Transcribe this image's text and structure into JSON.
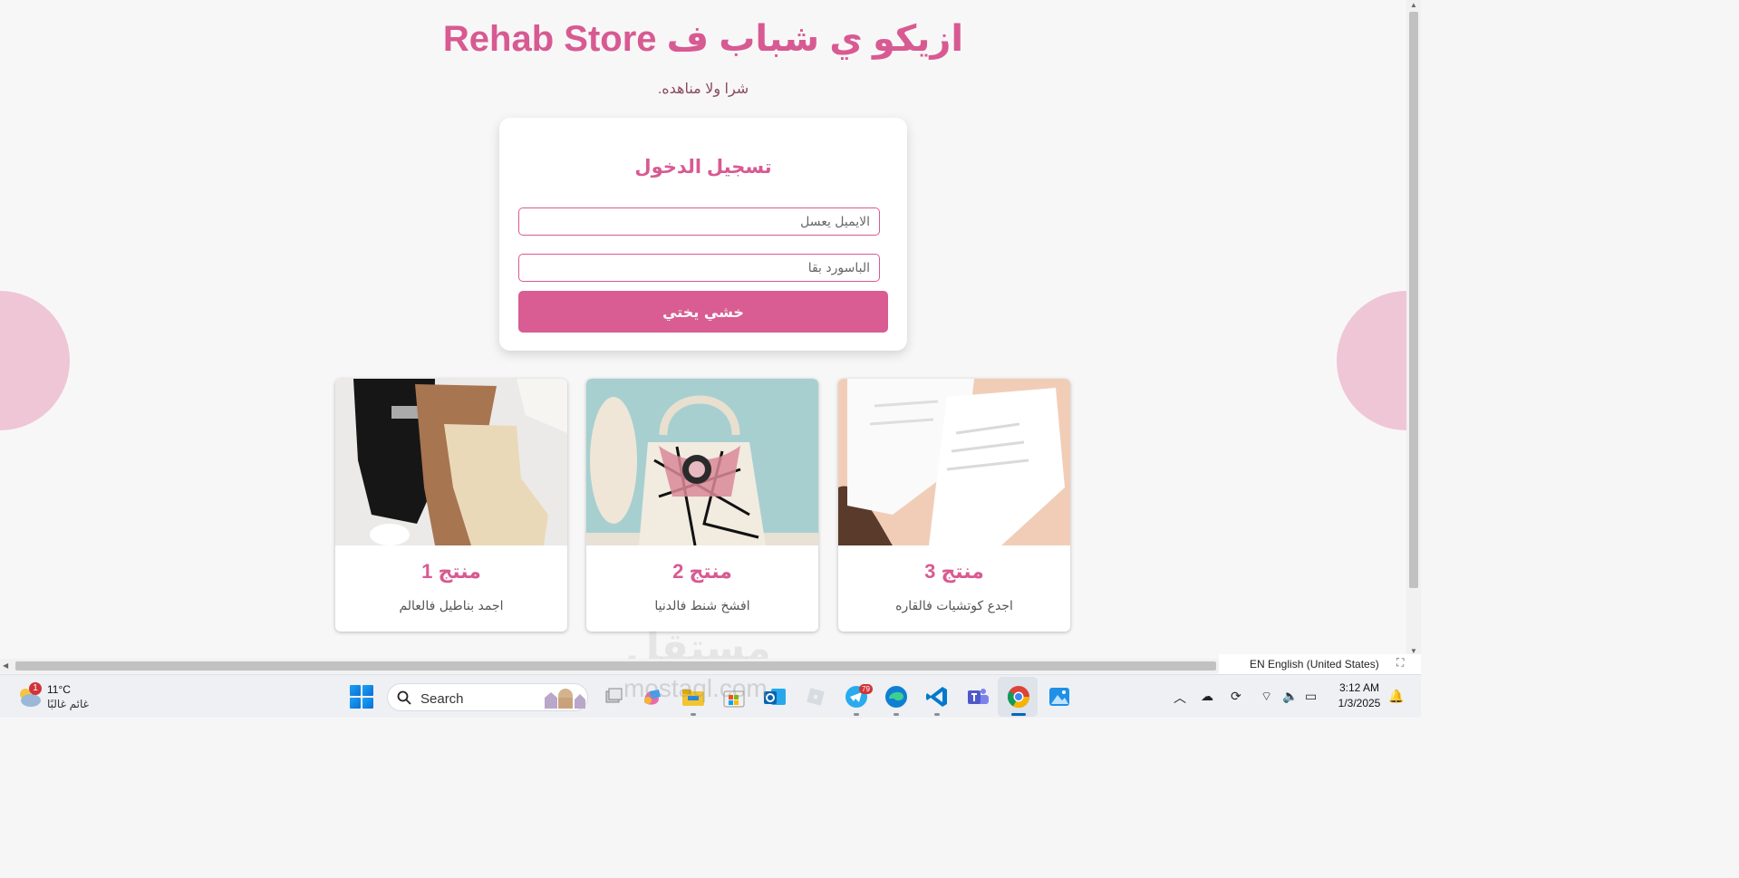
{
  "site": {
    "title": "ازيكو ي شباب ف Rehab Store",
    "tagline": "شرا ولا مناهده."
  },
  "login": {
    "title": "تسجيل الدخول",
    "email_placeholder": "الايميل يعسل",
    "password_placeholder": "الباسورد بقا",
    "submit_label": "خشي يختي"
  },
  "products": [
    {
      "name": "منتج 1",
      "description": "اجمد بناطيل فالعالم"
    },
    {
      "name": "منتج 2",
      "description": "افشخ شنط فالدنيا"
    },
    {
      "name": "منتج 3",
      "description": "اجدع كوتشيات فالقاره"
    }
  ],
  "watermark": {
    "arabic": "مستقل",
    "latin": "mostaql.com"
  },
  "ime": {
    "label": "EN English (United States)"
  },
  "taskbar": {
    "weather": {
      "temp": "11°C",
      "desc": "غائم غالبًا",
      "badge": "1"
    },
    "search_label": "Search",
    "telegram_badge": "79",
    "clock": {
      "time": "3:12 AM",
      "date": "1/3/2025"
    }
  },
  "colors": {
    "accent": "#d85a92",
    "circle": "#efc6d6",
    "button": "#d95c92"
  }
}
